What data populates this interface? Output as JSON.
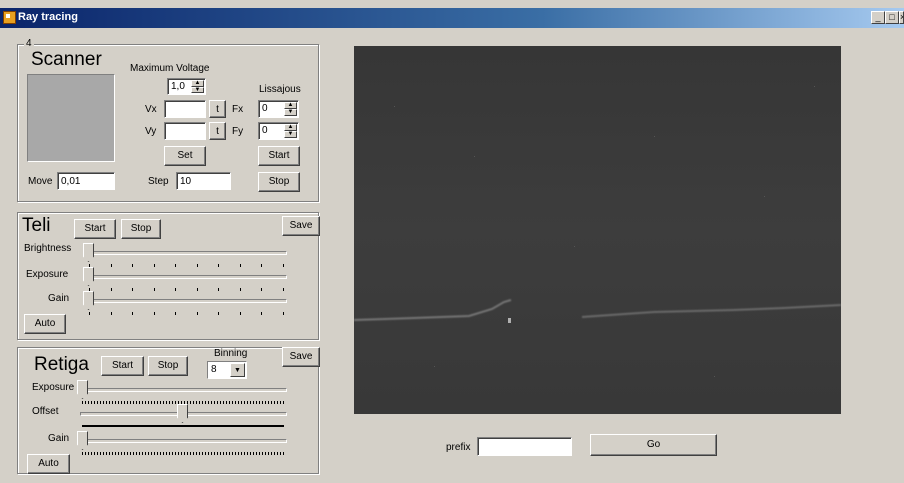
{
  "window": {
    "title": "Ray tracing"
  },
  "scanner": {
    "group_label": "4",
    "title": "Scanner",
    "max_voltage_label": "Maximum Voltage",
    "max_voltage_value": "1,0",
    "lissajous_label": "Lissajous",
    "vx_label": "Vx",
    "vy_label": "Vy",
    "vx_value": "",
    "vy_value": "",
    "t_label": "t",
    "fx_label": "Fx",
    "fy_label": "Fy",
    "fx_value": "0",
    "fy_value": "0",
    "set_label": "Set",
    "start_label": "Start",
    "stop_label": "Stop",
    "move_label": "Move",
    "move_value": "0,01",
    "step_label": "Step",
    "step_value": "10"
  },
  "teli": {
    "title": "Teli",
    "start_label": "Start",
    "stop_label": "Stop",
    "save_label": "Save",
    "brightness_label": "Brightness",
    "exposure_label": "Exposure",
    "gain_label": "Gain",
    "auto_label": "Auto",
    "brightness_level": 0,
    "exposure_level": 0,
    "gain_level": 0
  },
  "retiga": {
    "title": "Retiga",
    "start_label": "Start",
    "stop_label": "Stop",
    "save_label": "Save",
    "binning_label": "Binning",
    "binning_value": "8",
    "exposure_label": "Exposure",
    "offset_label": "Offset",
    "gain_label": "Gain",
    "auto_label": "Auto",
    "exposure_level": 0,
    "offset_level": 0.5,
    "gain_level": 0
  },
  "footer": {
    "prefix_label": "prefix",
    "prefix_value": "",
    "go_label": "Go"
  },
  "icons": [
    "app-icon",
    "minimize-icon",
    "maximize-icon",
    "close-icon"
  ]
}
